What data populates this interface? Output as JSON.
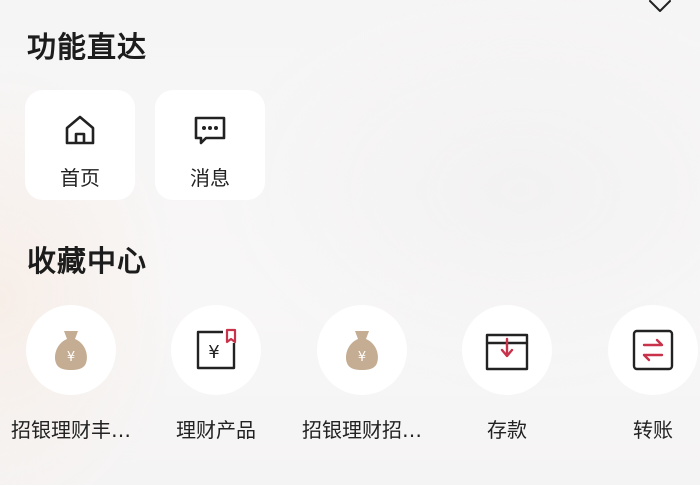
{
  "icons": {
    "close": "close-icon",
    "home": "home-icon",
    "message": "message-icon",
    "money_bag": "money-bag-icon",
    "wealth_product": "wealth-product-icon",
    "deposit": "deposit-icon",
    "transfer": "transfer-icon"
  },
  "colors": {
    "accent": "#c8324a",
    "bag": "#c4ad92",
    "icon_stroke": "#222222",
    "card_bg": "#ffffff"
  },
  "quick_access": {
    "title": "功能直达",
    "items": [
      {
        "label": "首页"
      },
      {
        "label": "消息"
      }
    ]
  },
  "favorites": {
    "title": "收藏中心",
    "items": [
      {
        "label": "招银理财丰…"
      },
      {
        "label": "理财产品"
      },
      {
        "label": "招银理财招…"
      },
      {
        "label": "存款"
      },
      {
        "label": "转账"
      }
    ]
  }
}
